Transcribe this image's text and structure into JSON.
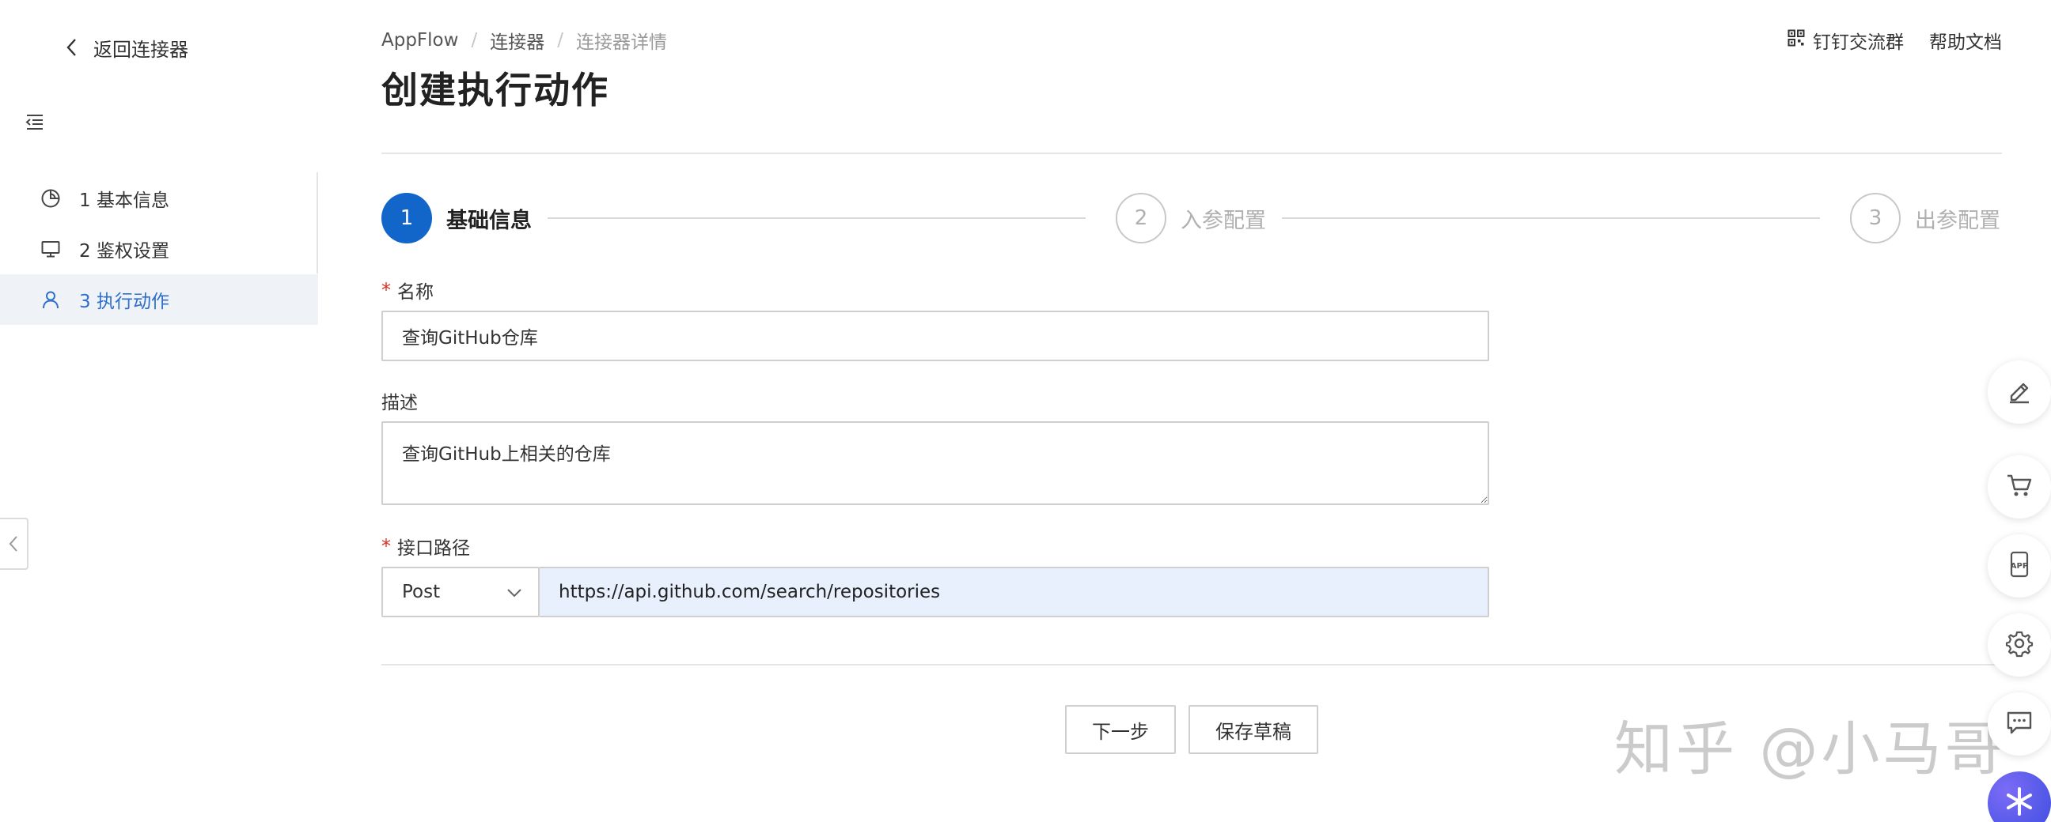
{
  "sidebar": {
    "back_label": "返回连接器",
    "items": [
      {
        "label": "1 基本信息",
        "icon": "pie-chart-icon",
        "active": false
      },
      {
        "label": "2 鉴权设置",
        "icon": "monitor-icon",
        "active": false
      },
      {
        "label": "3 执行动作",
        "icon": "user-icon",
        "active": true
      }
    ]
  },
  "header": {
    "breadcrumb": [
      "AppFlow",
      "连接器",
      "连接器详情"
    ],
    "title": "创建执行动作",
    "dingtalk_label": "钉钉交流群",
    "help_label": "帮助文档"
  },
  "steps": [
    {
      "number": "1",
      "label": "基础信息",
      "state": "active"
    },
    {
      "number": "2",
      "label": "入参配置",
      "state": "todo"
    },
    {
      "number": "3",
      "label": "出参配置",
      "state": "todo"
    }
  ],
  "form": {
    "name_label": "名称",
    "name_value": "查询GitHub仓库",
    "desc_label": "描述",
    "desc_value": "查询GitHub上相关的仓库",
    "path_label": "接口路径",
    "method_value": "Post",
    "url_value": "https://api.github.com/search/repositories",
    "required_mark": "*"
  },
  "actions": {
    "next_label": "下一步",
    "save_draft_label": "保存草稿"
  },
  "watermark": {
    "text": "知乎 @小马哥"
  },
  "colors": {
    "primary": "#1366c9",
    "active_nav_bg": "#eff3f8",
    "active_nav_text": "#2f6fcb",
    "required": "#d93026",
    "url_input_bg": "#e8f0fe"
  },
  "floating_tools": [
    "edit-icon",
    "cart-icon",
    "app-icon",
    "settings-icon",
    "chat-icon",
    "assistant-icon"
  ]
}
